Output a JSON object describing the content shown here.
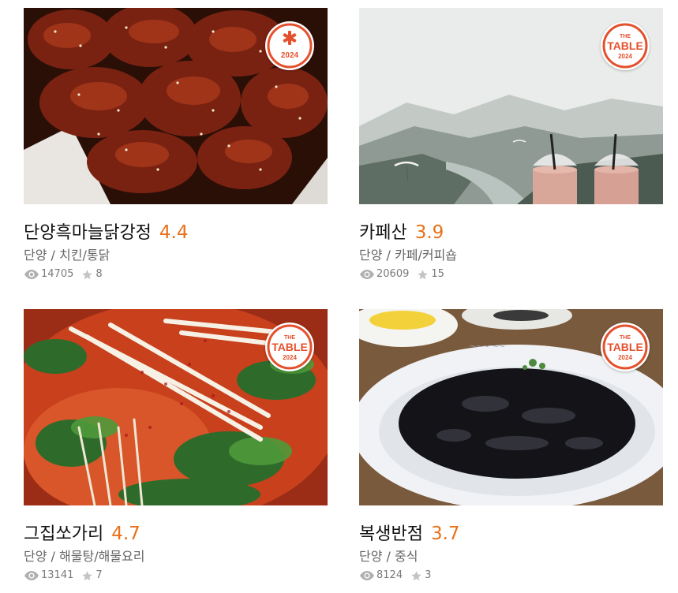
{
  "restaurants": [
    {
      "name": "단양흑마늘닭강정",
      "rating": "4.4",
      "region": "단양",
      "category": "치킨/통닭",
      "sep": "/",
      "views": "14705",
      "reviews": "8",
      "badge": {
        "type": "star",
        "year": "2024",
        "color": "#e4502d"
      },
      "photo": "fried-chicken"
    },
    {
      "name": "카페산",
      "rating": "3.9",
      "region": "단양",
      "category": "카페/커피숍",
      "sep": "/",
      "views": "20609",
      "reviews": "15",
      "badge": {
        "type": "table",
        "top": "THE",
        "word": "TABLE",
        "year": "2024",
        "color": "#e4502d"
      },
      "photo": "mountain-cafe"
    },
    {
      "name": "그집쏘가리",
      "rating": "4.7",
      "region": "단양",
      "category": "해물탕/해물요리",
      "sep": "/",
      "views": "13141",
      "reviews": "7",
      "badge": {
        "type": "table",
        "top": "THE",
        "word": "TABLE",
        "year": "2024",
        "color": "#e4502d"
      },
      "photo": "seafood-stew"
    },
    {
      "name": "복생반점",
      "rating": "3.7",
      "region": "단양",
      "category": "중식",
      "sep": "/",
      "views": "8124",
      "reviews": "3",
      "badge": {
        "type": "table",
        "top": "THE",
        "word": "TABLE",
        "year": "2024",
        "color": "#e4502d"
      },
      "photo": "jajangmyeon"
    }
  ],
  "colors": {
    "rating": "#e8711a",
    "badge": "#e4502d",
    "meta": "#7a7a7a"
  }
}
